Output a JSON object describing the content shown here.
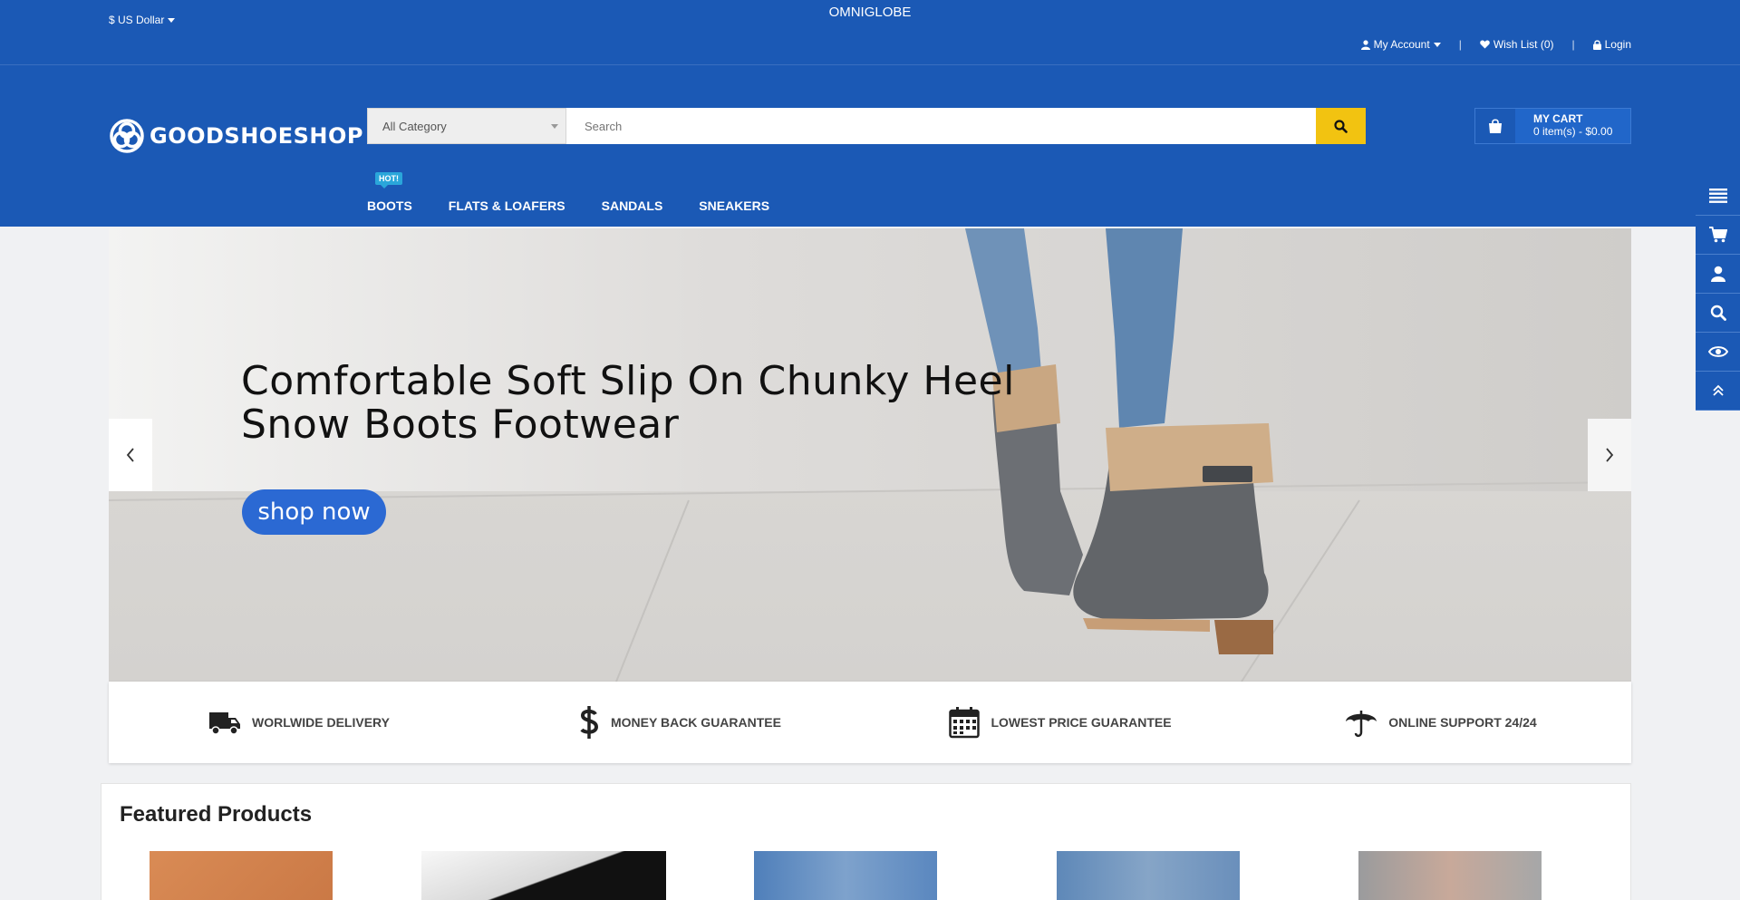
{
  "topbar": {
    "currency": "$ US Dollar",
    "site_name": "OMNIGLOBE",
    "my_account": "My Account",
    "wish_list": "Wish List (0)",
    "login": "Login"
  },
  "header": {
    "logo_text": "GOODSHOESHOP",
    "search": {
      "category": "All Category",
      "placeholder": "Search"
    },
    "cart": {
      "title": "MY CART",
      "summary": "0 item(s) - $0.00"
    }
  },
  "nav": {
    "items": [
      {
        "label": "BOOTS",
        "badge": "HOT!"
      },
      {
        "label": "FLATS & LOAFERS"
      },
      {
        "label": "SANDALS"
      },
      {
        "label": "SNEAKERS"
      }
    ]
  },
  "banner": {
    "headline": "Comfortable Soft Slip On Chunky Heel Snow Boots Footwear",
    "button": "shop now"
  },
  "features": [
    {
      "icon": "truck-icon",
      "label": "WORLWIDE DELIVERY"
    },
    {
      "icon": "dollar-icon",
      "label": "MONEY BACK GUARANTEE"
    },
    {
      "icon": "calendar-icon",
      "label": "LOWEST PRICE GUARANTEE"
    },
    {
      "icon": "umbrella-icon",
      "label": "ONLINE SUPPORT 24/24"
    }
  ],
  "featured": {
    "title": "Featured Products"
  },
  "sidebar": [
    "menu-icon",
    "cart-icon",
    "user-icon",
    "search-icon",
    "eye-icon",
    "chevrons-up-icon"
  ],
  "colors": {
    "brand_blue": "#1b59b5",
    "search_button": "#f2c311",
    "shop_button": "#2b69d3",
    "hot_badge": "#2aa6da"
  }
}
